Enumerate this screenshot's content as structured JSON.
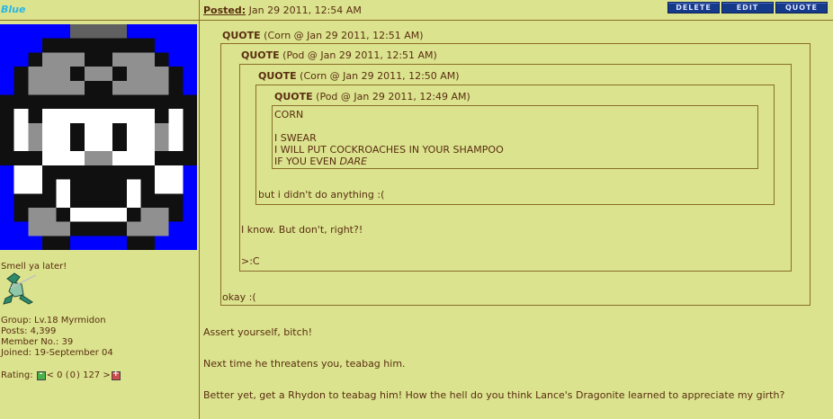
{
  "user": {
    "name": "Blue",
    "signature": "Smell ya later!",
    "group": "Group: Lv.18 Myrmidon",
    "posts": "Posts: 4,399",
    "member_no": "Member No.: 39",
    "joined": "Joined: 19-September 04",
    "rating_label": "Rating:",
    "rating_text_left": "< 0 (",
    "rating_value": "0",
    "rating_text_right": ") 127 >"
  },
  "post": {
    "posted_label": "Posted:",
    "posted_date": "Jan 29 2011, 12:54 AM",
    "buttons": {
      "delete": "DELETE",
      "edit": "EDIT",
      "quote": "QUOTE"
    },
    "quote1": {
      "label": "QUOTE",
      "meta": "(Corn @ Jan 29 2011, 12:51 AM)",
      "reply": "okay :("
    },
    "quote2": {
      "label": "QUOTE",
      "meta": "(Pod @ Jan 29 2011, 12:51 AM)",
      "reply1": "I know. But don't, right?!",
      "reply2": ">:C"
    },
    "quote3": {
      "label": "QUOTE",
      "meta": "(Corn @ Jan 29 2011, 12:50 AM)",
      "reply": "but i didn't do anything :("
    },
    "quote4": {
      "label": "QUOTE",
      "meta": "(Pod @ Jan 29 2011, 12:49 AM)",
      "line1": "CORN",
      "line2": "I SWEAR",
      "line3": "I WILL PUT COCKROACHES IN YOUR SHAMPOO",
      "line4_pre": "IF YOU EVEN ",
      "line4_em": "DARE"
    },
    "body1": "Assert yourself, bitch!",
    "body2": "Next time he threatens you, teabag him.",
    "body3": "Better yet, get a Rhydon to teabag him! How the hell do you think Lance's Dragonite learned to appreciate my girth?"
  },
  "colors": {
    "background": "#dbe38f",
    "text": "#5a2e10",
    "username": "#29b6e6",
    "border": "#8a6d2a",
    "button": "#163a8a"
  }
}
